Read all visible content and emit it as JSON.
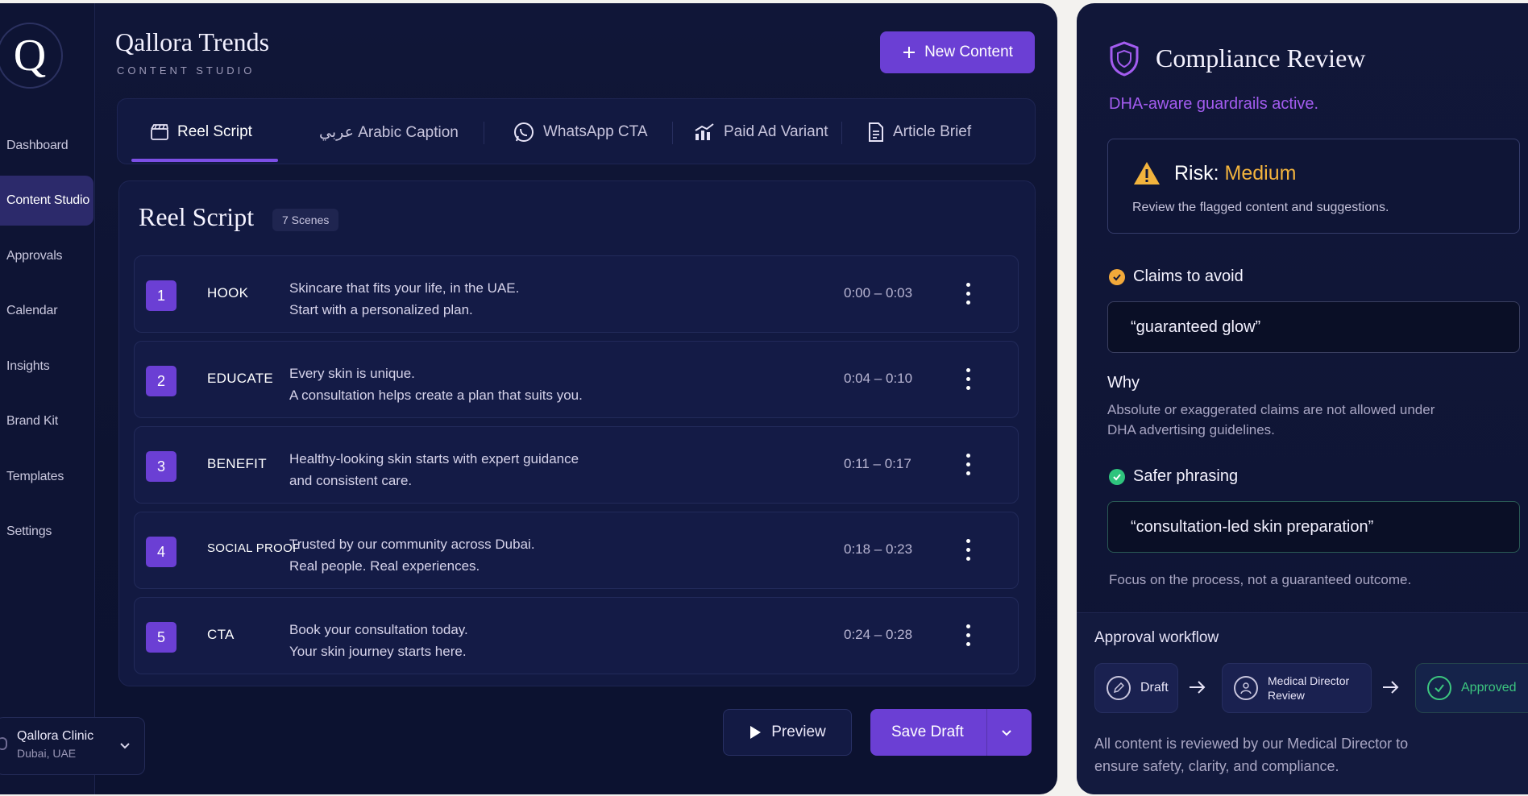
{
  "brand": {
    "title": "Qallora Trends",
    "subtitle": "CONTENT STUDIO",
    "logo_letter": "Q"
  },
  "sidebar": {
    "items": [
      {
        "label": "Dashboard",
        "active": false
      },
      {
        "label": "Content Studio",
        "active": true
      },
      {
        "label": "Approvals",
        "active": false
      },
      {
        "label": "Calendar",
        "active": false
      },
      {
        "label": "Insights",
        "active": false
      },
      {
        "label": "Brand Kit",
        "active": false
      },
      {
        "label": "Templates",
        "active": false
      },
      {
        "label": "Settings",
        "active": false
      }
    ],
    "clinic": {
      "name": "Qallora Clinic",
      "location": "Dubai, UAE"
    }
  },
  "header": {
    "new_content_label": "New Content"
  },
  "tabs": [
    {
      "label": "Reel Script",
      "icon": "clapperboard-icon",
      "active": true
    },
    {
      "label": "عربي  Arabic Caption",
      "icon": "",
      "active": false
    },
    {
      "label": "WhatsApp CTA",
      "icon": "whatsapp-icon",
      "active": false
    },
    {
      "label": "Paid Ad Variant",
      "icon": "chart-icon",
      "active": false
    },
    {
      "label": "Article Brief",
      "icon": "document-icon",
      "active": false
    }
  ],
  "script": {
    "title": "Reel Script",
    "scene_count": "7 Scenes",
    "rows": [
      {
        "num": "1",
        "tag": "HOOK",
        "line1": "Skincare that fits your life, in the UAE.",
        "line2": "Start with a personalized plan.",
        "time": "0:00 – 0:03"
      },
      {
        "num": "2",
        "tag": "EDUCATE",
        "line1": "Every skin is unique.",
        "line2": "A consultation helps create a plan that suits you.",
        "time": "0:04 – 0:10"
      },
      {
        "num": "3",
        "tag": "BENEFIT",
        "line1": "Healthy-looking skin starts with expert guidance",
        "line2": "and consistent care.",
        "time": "0:11 – 0:17"
      },
      {
        "num": "4",
        "tag": "SOCIAL PROOF",
        "line1": "Trusted by our community across Dubai.",
        "line2": "Real people. Real experiences.",
        "time": "0:18 – 0:23"
      },
      {
        "num": "5",
        "tag": "CTA",
        "line1": "Book your consultation today.",
        "line2": "Your skin journey starts here.",
        "time": "0:24 – 0:28"
      }
    ]
  },
  "actions": {
    "preview_label": "Preview",
    "save_draft_label": "Save Draft"
  },
  "compliance": {
    "title": "Compliance Review",
    "subtitle": "DHA-aware guardrails active.",
    "risk_label": "Risk:",
    "risk_value": "Medium",
    "risk_desc": "Review the flagged content and suggestions.",
    "claims_title": "Claims to avoid",
    "claim_text": "“guaranteed glow”",
    "why_title": "Why",
    "why_text": "Absolute or exaggerated claims are not allowed under DHA advertising guidelines.",
    "safer_title": "Safer phrasing",
    "safer_text": "“consultation-led skin preparation”",
    "focus_text": "Focus on the process, not a guaranteed outcome.",
    "workflow": {
      "title": "Approval workflow",
      "steps": [
        "Draft",
        "Medical Director Review",
        "Approved"
      ],
      "note": "All content is reviewed by our Medical Director to ensure safety, clarity, and compliance."
    }
  },
  "colors": {
    "accent": "#6b3fd4",
    "risk": "#f2b33d",
    "success": "#2fc47d",
    "subtitle": "#a35cf0"
  }
}
